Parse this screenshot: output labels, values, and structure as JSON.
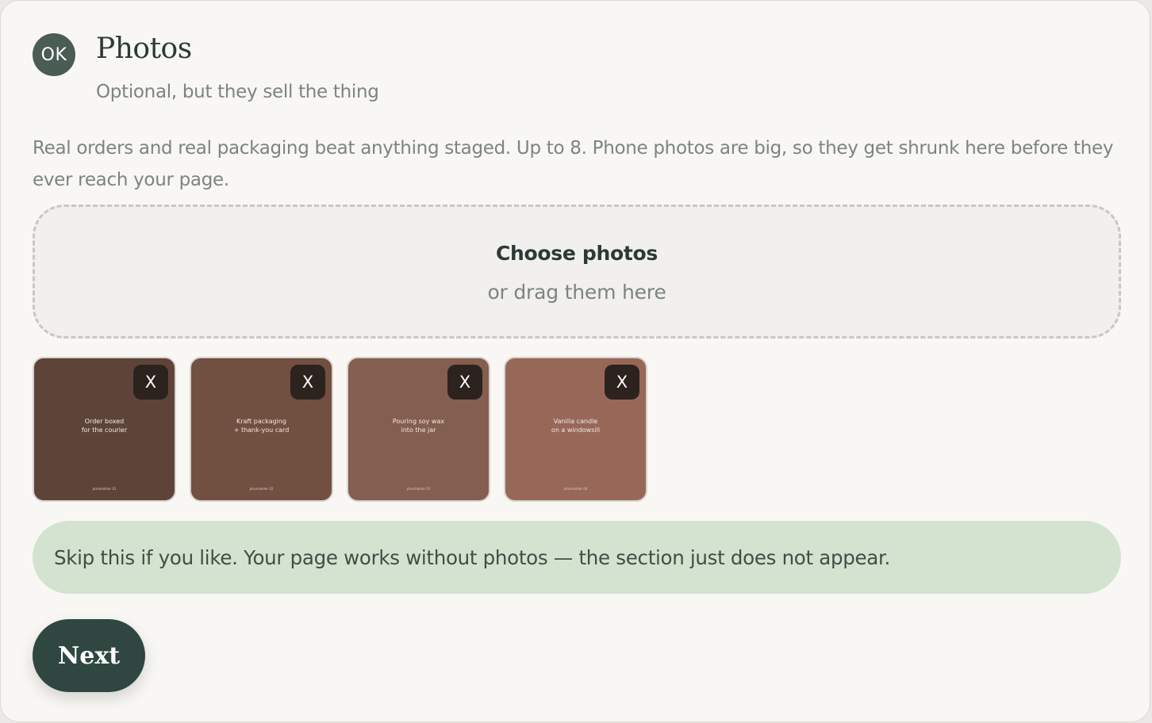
{
  "step": {
    "badge": "OK",
    "title": "Photos",
    "subtitle": "Optional, but they sell the thing"
  },
  "description": "Real orders and real packaging beat anything staged. Up to 8. Phone photos are big, so they get shrunk here before they ever reach your page.",
  "dropzone": {
    "choose_label": "Choose photos",
    "drag_label": "or drag them here"
  },
  "photos": [
    {
      "caption_line1": "Order boxed",
      "caption_line2": "for the courier",
      "placeholder": "placeholder 01",
      "remove_label": "X",
      "color": "#5e4438"
    },
    {
      "caption_line1": "Kraft packaging",
      "caption_line2": "+ thank-you card",
      "placeholder": "placeholder 02",
      "remove_label": "X",
      "color": "#714f41"
    },
    {
      "caption_line1": "Pouring soy wax",
      "caption_line2": "into the jar",
      "placeholder": "placeholder 03",
      "remove_label": "X",
      "color": "#845e4f"
    },
    {
      "caption_line1": "Vanilla candle",
      "caption_line2": "on a windowsill",
      "placeholder": "placeholder 04",
      "remove_label": "X",
      "color": "#976858"
    }
  ],
  "note": "Skip this if you like. Your page works without photos — the section just does not appear.",
  "next_label": "Next",
  "colors": {
    "accent": "#2f4740",
    "badge": "#4a5c54",
    "note_bg": "#d4e3cf"
  }
}
